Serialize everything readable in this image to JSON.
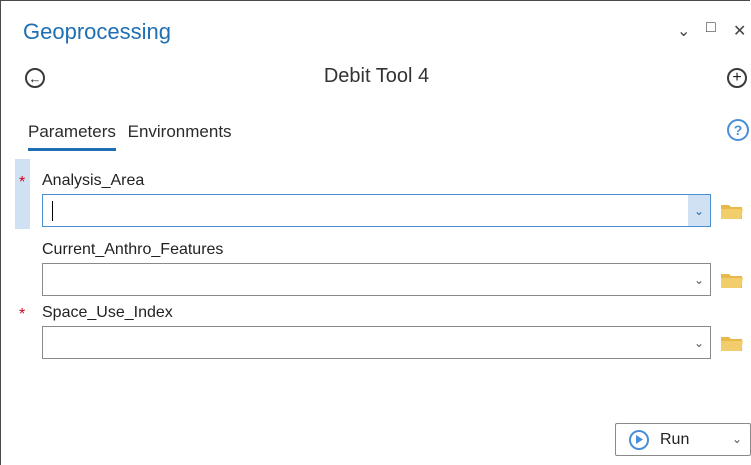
{
  "pane": {
    "title": "Geoprocessing",
    "controls": {
      "options_icon": "⌄",
      "maximize_icon": "□",
      "close_icon": "✕"
    }
  },
  "tool": {
    "back_icon": "←",
    "title": "Debit Tool 4",
    "add_icon": "+"
  },
  "tabs": [
    {
      "label": "Parameters",
      "active": true
    },
    {
      "label": "Environments",
      "active": false
    }
  ],
  "help_icon": "?",
  "parameters": [
    {
      "label": "Analysis_Area",
      "required": true,
      "value": "",
      "focused": true
    },
    {
      "label": "Current_Anthro_Features",
      "required": false,
      "value": "",
      "focused": false
    },
    {
      "label": "Space_Use_Index",
      "required": true,
      "value": "",
      "focused": false
    }
  ],
  "required_marker": "*",
  "dropdown_icon": "⌄",
  "run_button": {
    "label": "Run",
    "dropdown_icon": "⌄"
  },
  "colors": {
    "accent": "#1f6fb4",
    "required": "#d0021b",
    "folder": "#e8b84a",
    "highlight": "#cfe1f2"
  }
}
